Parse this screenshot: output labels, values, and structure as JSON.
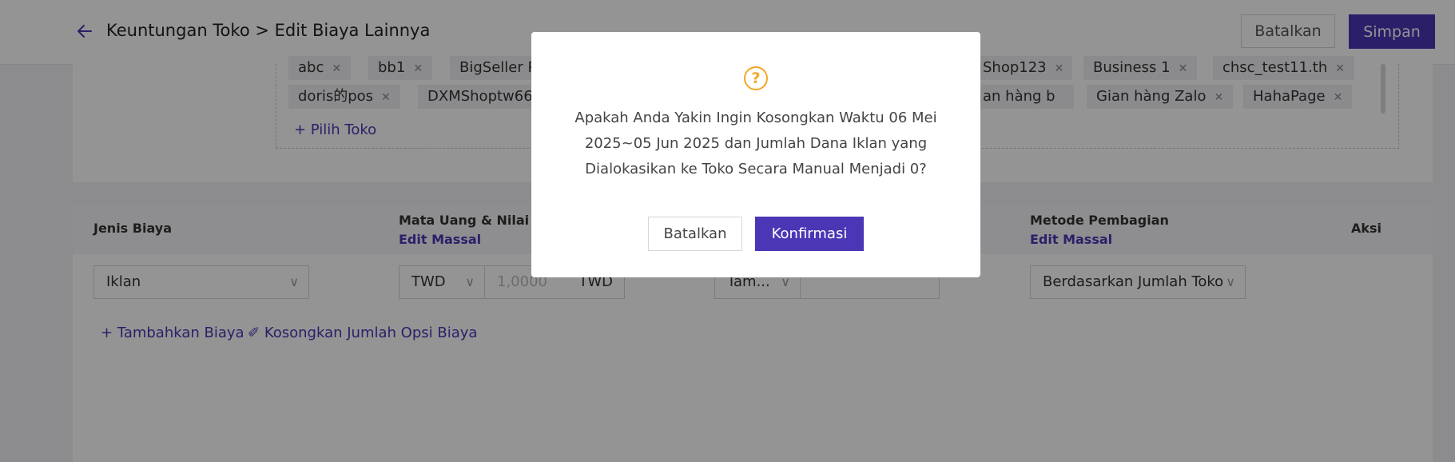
{
  "header": {
    "title": "Keuntungan Toko > Edit Biaya Lainnya",
    "cancel_label": "Batalkan",
    "save_label": "Simpan"
  },
  "shops": {
    "row1": [
      "abc",
      "bb1",
      "BigSeller P",
      "Shop123",
      "Business 1",
      "chsc_test11.th"
    ],
    "row2": [
      "doris的pos",
      "DXMShoptw666",
      "an hàng b",
      "Gian hàng Zalo",
      "HahaPage"
    ],
    "select_shop_label": "+ Pilih Toko"
  },
  "table": {
    "headers": {
      "fee_type": "Jenis Biaya",
      "currency_value": "Mata Uang & Nilai Tu",
      "allocation_method": "Metode Pembagian",
      "action": "Aksi"
    },
    "bulk_edit": "Edit Massal",
    "row": {
      "fee_type": "Iklan",
      "currency": "TWD",
      "amount_placeholder": "1,0000",
      "amount_unit": "TWD",
      "time_select": "Tam...",
      "method": "Berdasarkan Jumlah Toko"
    },
    "add_fee": "+ Tambahkan Biaya",
    "clear_fee": "Kosongkan Jumlah Opsi Biaya"
  },
  "modal": {
    "icon": "question-circle-icon",
    "message_line1": "Apakah Anda Yakin Ingin Kosongkan Waktu 06 Mei",
    "message_line2": "2025~05 Jun 2025 dan Jumlah Dana Iklan yang",
    "message_line3": "Dialokasikan ke Toko Secara Manual Menjadi 0?",
    "cancel_label": "Batalkan",
    "confirm_label": "Konfirmasi"
  },
  "colors": {
    "accent": "#4b36b5",
    "warning": "#f5a623"
  }
}
